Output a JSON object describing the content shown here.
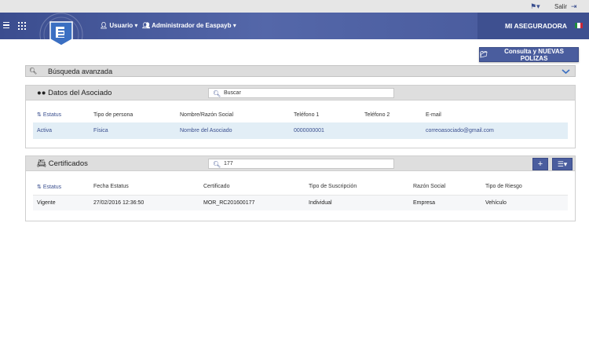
{
  "topbar": {
    "logout_label": "Salir"
  },
  "navbar": {
    "user_menu": "Usuario",
    "admin_menu": "Administrador de Easpayb",
    "brand": "MI ASEGURADORA"
  },
  "actions": {
    "consulta_label": "Consulta y NUEVAS POLIZAS"
  },
  "advanced_search": {
    "title": "Búsqueda avanzada"
  },
  "asociado": {
    "title": "Datos del Asociado",
    "search_placeholder": "Buscar",
    "columns": [
      "Estatus",
      "Tipo de persona",
      "Nombre/Razón Social",
      "Teléfono 1",
      "Teléfono 2",
      "E-mail"
    ],
    "rows": [
      [
        "Activa",
        "Física",
        "Nombre del Asociado",
        "0000000001",
        "",
        "correoasociado@gmail.com"
      ]
    ]
  },
  "certificados": {
    "title": "Certificados",
    "search_value": "177",
    "columns": [
      "Estatus",
      "Fecha Estatus",
      "Certificado",
      "Tipo de Suscripción",
      "Razón Social",
      "Tipo de Riesgo"
    ],
    "rows": [
      [
        "Vigente",
        "27/02/2016 12:36:50",
        "MOR_RC201600177",
        "Individual",
        "Empresa",
        "Vehículo"
      ]
    ]
  },
  "colors": {
    "primary": "#4a5d9e",
    "nav": "#4a5c9d",
    "row_highlight": "#e2eef6"
  }
}
